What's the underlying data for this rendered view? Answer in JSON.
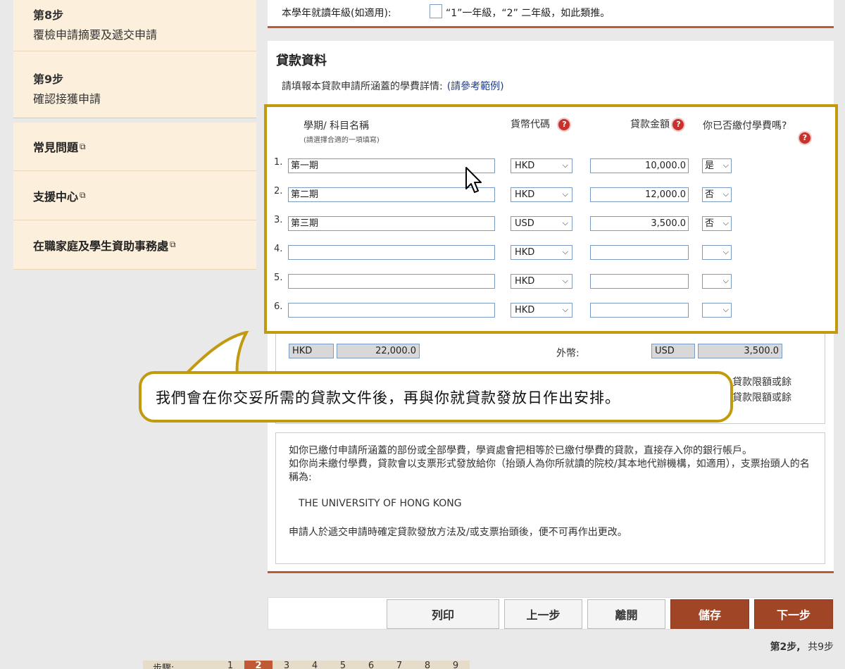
{
  "sidebar": {
    "steps": [
      {
        "num": "第8步",
        "name": "覆檢申請摘要及遞交申請"
      },
      {
        "num": "第9步",
        "name": "確認接獲申請"
      }
    ],
    "links": [
      {
        "label": "常見問題"
      },
      {
        "label": "支援中心"
      },
      {
        "label": "在職家庭及學生資助事務處"
      }
    ]
  },
  "grade": {
    "label": "本學年就讀年級(如適用):",
    "hint": "“1”一年級，“2” 二年級，如此類推。"
  },
  "loan": {
    "title": "貸款資料",
    "desc": "請填報本貸款申請所涵蓋的學費詳情:",
    "desc_link": "(請參考範例)",
    "headers": {
      "term": "學期/ 科目名稱",
      "term_sub": "(請選擇合適的一項填寫)",
      "currency": "貨幣代碼",
      "amount": "貸款金額",
      "paid": "你已否繳付學費嗎?"
    },
    "rows": [
      {
        "num": "1.",
        "term": "第一期",
        "currency": "HKD",
        "amount": "10,000.0",
        "paid": "是"
      },
      {
        "num": "2.",
        "term": "第二期",
        "currency": "HKD",
        "amount": "12,000.0",
        "paid": "否"
      },
      {
        "num": "3.",
        "term": "第三期",
        "currency": "USD",
        "amount": "3,500.0",
        "paid": "否"
      },
      {
        "num": "4.",
        "term": "",
        "currency": "HKD",
        "amount": "",
        "paid": ""
      },
      {
        "num": "5.",
        "term": "",
        "currency": "HKD",
        "amount": "",
        "paid": ""
      },
      {
        "num": "6.",
        "term": "",
        "currency": "HKD",
        "amount": "",
        "paid": ""
      }
    ],
    "totals": {
      "local_currency": "HKD",
      "local_amount": "22,000.0",
      "foreign_label": "外幣:",
      "foreign_currency": "USD",
      "foreign_amount": "3,500.0"
    },
    "partial_text_1": "貸款限額或餘",
    "partial_text_2": "貸款限額或餘"
  },
  "info": {
    "line1": "如你已繳付申請所涵蓋的部份或全部學費，學資處會把相等於已繳付學費的貸款，直接存入你的銀行帳戶。",
    "line2": "如你尚未繳付學費，貸款會以支票形式發放給你（抬頭人為你所就讀的院校/其本地代辦機構，如適用），支票抬頭人的名稱為:",
    "payee": "THE UNIVERSITY OF HONG KONG",
    "line3": "申請人於遞交申請時確定貸款發放方法及/或支票抬頭後，便不可再作出更改。"
  },
  "callout": {
    "text": "我們會在你交妥所需的貸款文件後，再與你就貸款發放日作出安排。"
  },
  "buttons": {
    "print": "列印",
    "prev": "上一步",
    "leave": "離開",
    "save": "儲存",
    "next": "下一步"
  },
  "step_count": {
    "current": "第2步,",
    "total": "共9步"
  },
  "pager": {
    "label": "步驟:",
    "pages": [
      "1",
      "2",
      "3",
      "4",
      "5",
      "6",
      "7",
      "8",
      "9"
    ],
    "current": "2"
  },
  "icons": {
    "help": "question-icon",
    "external": "external-link-icon",
    "dropdown": "chevron-down-icon",
    "cursor": "mouse-pointer-icon"
  },
  "colors": {
    "accent": "#c05a34",
    "highlight": "#c29a10",
    "button_primary": "#a14527",
    "sidebar_bg": "#fcefdc"
  }
}
